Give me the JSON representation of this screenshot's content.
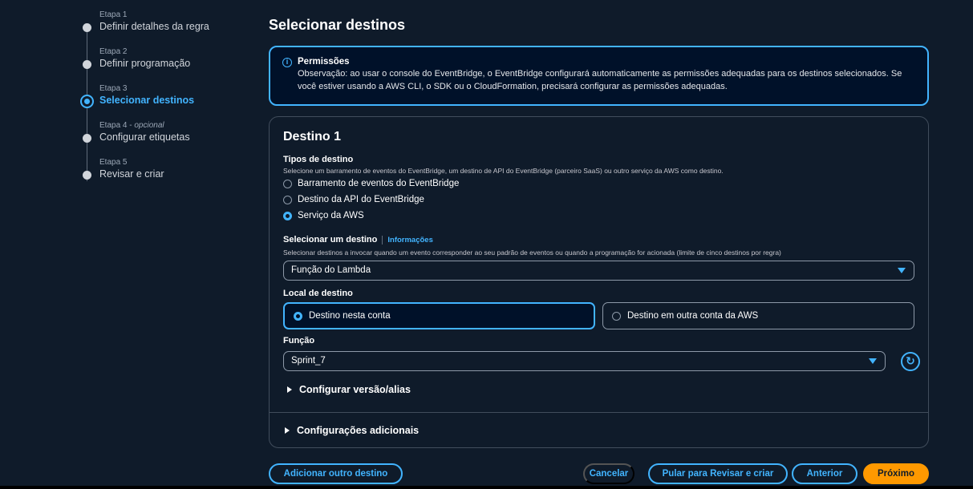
{
  "steps": [
    {
      "label": "Etapa 1",
      "optional": "",
      "name": "Definir detalhes da regra",
      "state": "complete"
    },
    {
      "label": "Etapa 2",
      "optional": "",
      "name": "Definir programação",
      "state": "complete"
    },
    {
      "label": "Etapa 3",
      "optional": "",
      "name": "Selecionar destinos",
      "state": "active"
    },
    {
      "label": "Etapa 4 - ",
      "optional": "opcional",
      "name": "Configurar etiquetas",
      "state": "pending"
    },
    {
      "label": "Etapa 5",
      "optional": "",
      "name": "Revisar e criar",
      "state": "pending"
    }
  ],
  "page_title": "Selecionar destinos",
  "info": {
    "title": "Permissões",
    "body": "Observação: ao usar o console do EventBridge, o EventBridge configurará automaticamente as permissões adequadas para os destinos selecionados. Se você estiver usando a AWS CLI, o SDK ou o CloudFormation, precisará configurar as permissões adequadas."
  },
  "target": {
    "heading": "Destino 1",
    "types_label": "Tipos de destino",
    "types_desc": "Selecione um barramento de eventos do EventBridge, um destino de API do EventBridge (parceiro SaaS) ou outro serviço da AWS como destino.",
    "types": [
      {
        "label": "Barramento de eventos do EventBridge",
        "selected": false
      },
      {
        "label": "Destino da API do EventBridge",
        "selected": false
      },
      {
        "label": "Serviço da AWS",
        "selected": true
      }
    ],
    "select_label": "Selecionar um destino",
    "select_info": "Informações",
    "select_desc": "Selecionar destinos a invocar quando um evento corresponder ao seu padrão de eventos ou quando a programação for acionada (limite de cinco destinos por regra)",
    "select_value": "Função do Lambda",
    "location_label": "Local de destino",
    "location_options": [
      {
        "label": "Destino nesta conta",
        "selected": true
      },
      {
        "label": "Destino em outra conta da AWS",
        "selected": false
      }
    ],
    "function_label": "Função",
    "function_value": "Sprint_7",
    "version_expander": "Configurar versão/alias",
    "additional_expander": "Configurações adicionais"
  },
  "footer": {
    "add_target": "Adicionar outro destino",
    "cancel": "Cancelar",
    "skip": "Pular para Revisar e criar",
    "previous": "Anterior",
    "next": "Próximo"
  },
  "colors": {
    "background": "#0f1b2a",
    "accent": "#42b4ff",
    "primary_button": "#ff9900",
    "border": "#414d5c"
  }
}
